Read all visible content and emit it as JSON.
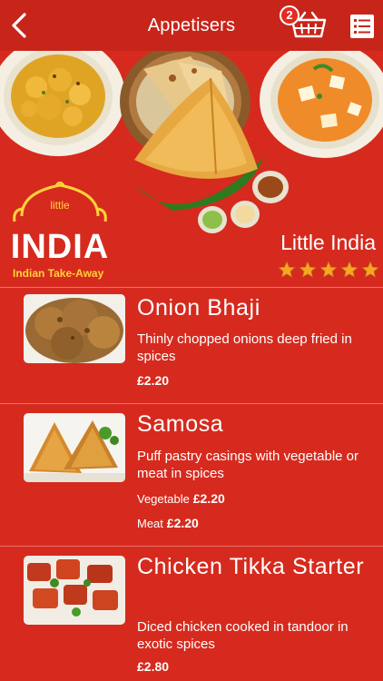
{
  "header": {
    "title": "Appetisers",
    "cart_count": "2"
  },
  "restaurant": {
    "logo_word": "INDIA",
    "logo_small": "little",
    "logo_tagline": "Indian Take-Away",
    "name": "Little India",
    "rating": 5
  },
  "items": [
    {
      "name": "Onion Bhaji",
      "description": "Thinly chopped onions deep fried in spices",
      "price": "£2.20"
    },
    {
      "name": "Samosa",
      "description": "Puff pastry casings with vegetable or meat in spices",
      "prices": [
        {
          "label": "Vegetable",
          "price": "£2.20"
        },
        {
          "label": "Meat",
          "price": "£2.20"
        }
      ]
    },
    {
      "name": "Chicken Tikka Starter",
      "description": "Diced chicken cooked in tandoor in exotic spices",
      "price": "£2.80"
    }
  ],
  "colors": {
    "background": "#d62a1e",
    "navbar": "#c8251a",
    "logo_yellow": "#ffd23a",
    "star": "#f6a623"
  },
  "icons": {
    "back": "chevron-left-icon",
    "cart": "basket-icon",
    "menu": "list-icon",
    "star": "star-icon"
  }
}
